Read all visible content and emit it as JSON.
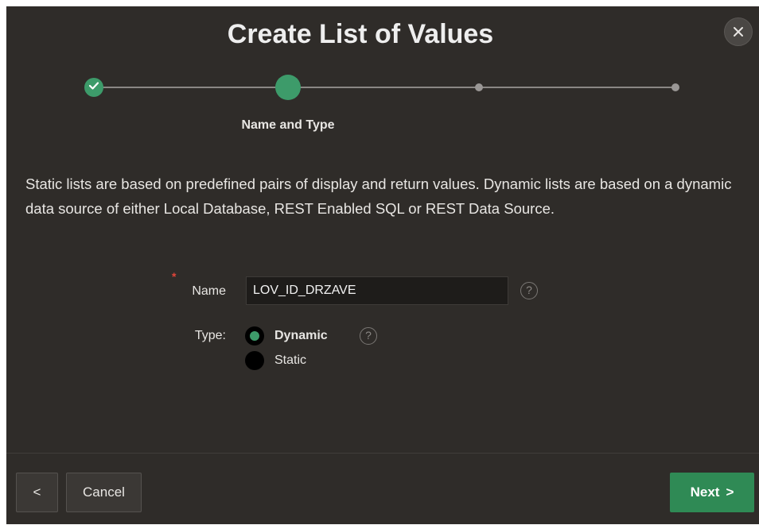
{
  "dialog": {
    "title": "Create List of Values",
    "close_icon": "close-icon"
  },
  "wizard": {
    "current_step_label": "Name and Type",
    "steps_total": 4,
    "current_step": 2,
    "accent_color": "#3d9b6a"
  },
  "description": "Static lists are based on predefined pairs of display and return values. Dynamic lists are based on a dynamic data source of either Local Database, REST Enabled SQL or REST Data Source.",
  "form": {
    "name_required_mark": "*",
    "name_label": "Name",
    "name_value": "LOV_ID_DRZAVE",
    "help_symbol": "?",
    "type_label": "Type:",
    "type_options": [
      {
        "label": "Dynamic",
        "selected": true
      },
      {
        "label": "Static",
        "selected": false
      }
    ]
  },
  "footer": {
    "back_symbol": "<",
    "cancel_label": "Cancel",
    "next_label": "Next",
    "next_symbol": ">",
    "next_color": "#2f8a55"
  }
}
